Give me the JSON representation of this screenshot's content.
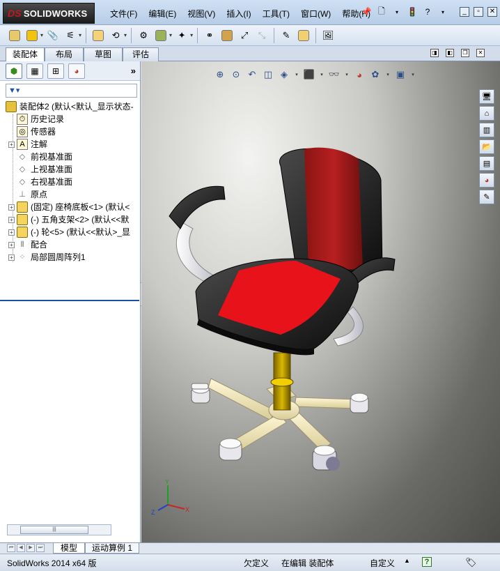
{
  "app": {
    "logo_text": "SOLIDWORKS",
    "logo_prefix": "DS"
  },
  "menu": [
    "文件(F)",
    "编辑(E)",
    "视图(V)",
    "插入(I)",
    "工具(T)",
    "窗口(W)",
    "帮助(H)"
  ],
  "command_tabs": [
    "装配体",
    "布局",
    "草图",
    "评估"
  ],
  "feature_tree": {
    "filter_icon": "funnel-icon",
    "root": "装配体2  (默认<默认_显示状态-",
    "items": [
      {
        "label": "历史记录",
        "icon": "history-icon",
        "expand": ""
      },
      {
        "label": "传感器",
        "icon": "sensor-icon",
        "expand": ""
      },
      {
        "label": "注解",
        "icon": "annotation-icon",
        "expand": "+"
      },
      {
        "label": "前视基准面",
        "icon": "plane-icon",
        "expand": ""
      },
      {
        "label": "上视基准面",
        "icon": "plane-icon",
        "expand": ""
      },
      {
        "label": "右视基准面",
        "icon": "plane-icon",
        "expand": ""
      },
      {
        "label": "原点",
        "icon": "origin-icon",
        "expand": ""
      },
      {
        "label": "(固定) 座椅底板<1> (默认<",
        "icon": "part-icon",
        "expand": "+"
      },
      {
        "label": "(-) 五角支架<2> (默认<<默",
        "icon": "part-icon",
        "expand": "+"
      },
      {
        "label": "(-) 轮<5> (默认<<默认>_显",
        "icon": "part-icon",
        "expand": "+"
      },
      {
        "label": "配合",
        "icon": "mate-icon",
        "expand": "+"
      },
      {
        "label": "局部圆周阵列1",
        "icon": "pattern-icon",
        "expand": "+"
      }
    ]
  },
  "bottom_tabs": [
    "模型",
    "运动算例 1"
  ],
  "status": {
    "version": "SolidWorks 2014 x64 版",
    "definition": "欠定义",
    "mode": "在编辑 装配体",
    "units": "自定义"
  },
  "colors": {
    "seat_red": "#e8121a",
    "seat_black": "#1b1b1b",
    "frame_white": "#e9e9ee",
    "base_cream": "#f2e9bf",
    "column_gold": "#c7a400",
    "titlebar": "#c3d6ee"
  },
  "triad": {
    "x_label": "X",
    "y_label": "Y",
    "z_label": "Z"
  }
}
